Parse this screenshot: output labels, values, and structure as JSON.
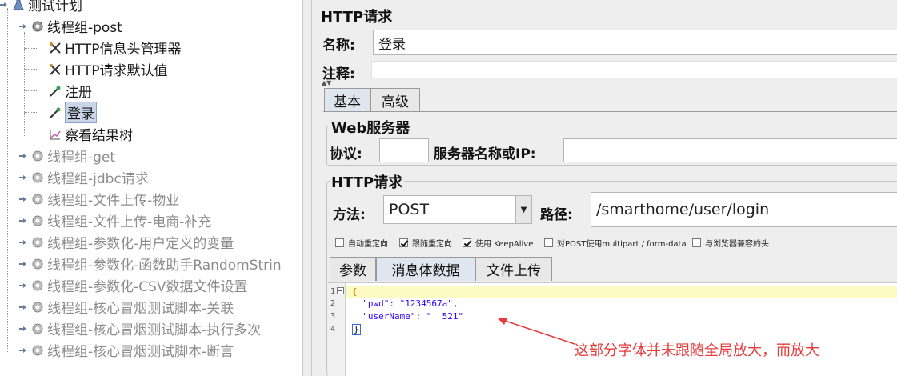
{
  "tree": {
    "root": "测试计划",
    "nodes": [
      {
        "label": "线程组-post",
        "gray": false
      },
      {
        "label": "HTTP信息头管理器",
        "gray": false
      },
      {
        "label": "HTTP请求默认值",
        "gray": false
      },
      {
        "label": "注册",
        "gray": false
      },
      {
        "label": "登录",
        "gray": false
      },
      {
        "label": "察看结果树",
        "gray": false
      },
      {
        "label": "线程组-get",
        "gray": true
      },
      {
        "label": "线程组-jdbc请求",
        "gray": true
      },
      {
        "label": "线程组-文件上传-物业",
        "gray": true
      },
      {
        "label": "线程组-文件上传-电商-补充",
        "gray": true
      },
      {
        "label": "线程组-参数化-用户定义的变量",
        "gray": true
      },
      {
        "label": "线程组-参数化-函数助手RandomStrin",
        "gray": true
      },
      {
        "label": "线程组-参数化-CSV数据文件设置",
        "gray": true
      },
      {
        "label": "线程组-核心冒烟测试脚本-关联",
        "gray": true
      },
      {
        "label": "线程组-核心冒烟测试脚本-执行多次",
        "gray": true
      },
      {
        "label": "线程组-核心冒烟测试脚本-断言",
        "gray": true
      }
    ]
  },
  "panel": {
    "title": "HTTP请求",
    "name_label": "名称:",
    "name_value": "登录",
    "comment_label": "注释:",
    "tabs": [
      "基本",
      "高级"
    ],
    "web_server": {
      "section_title": "Web服务器",
      "protocol_label": "协议:",
      "protocol_value": "",
      "server_label": "服务器名称或IP:",
      "server_value": ""
    },
    "http_request": {
      "section_title": "HTTP请求",
      "method_label": "方法:",
      "method_value": "POST",
      "path_label": "路径:",
      "path_value": "/smarthome/user/login"
    },
    "checkboxes": [
      {
        "label": "自动重定向",
        "checked": false
      },
      {
        "label": "跟随重定向",
        "checked": true
      },
      {
        "label": "使用 KeepAlive",
        "checked": true
      },
      {
        "label": "对POST使用multipart / form-data",
        "checked": false
      },
      {
        "label": "与浏览器兼容的头",
        "checked": false
      }
    ],
    "body_tabs": [
      "参数",
      "消息体数据",
      "文件上传"
    ],
    "editor": {
      "line_numbers": [
        "1",
        "2",
        "3",
        "4"
      ],
      "lines": [
        "{",
        "  \"pwd\": \"1234567a\",",
        "  \"userName\": \"  521\"",
        "}"
      ]
    }
  },
  "annotation": {
    "text": "这部分字体并未跟随全局放大，而放大",
    "color": "#e53b3b"
  }
}
